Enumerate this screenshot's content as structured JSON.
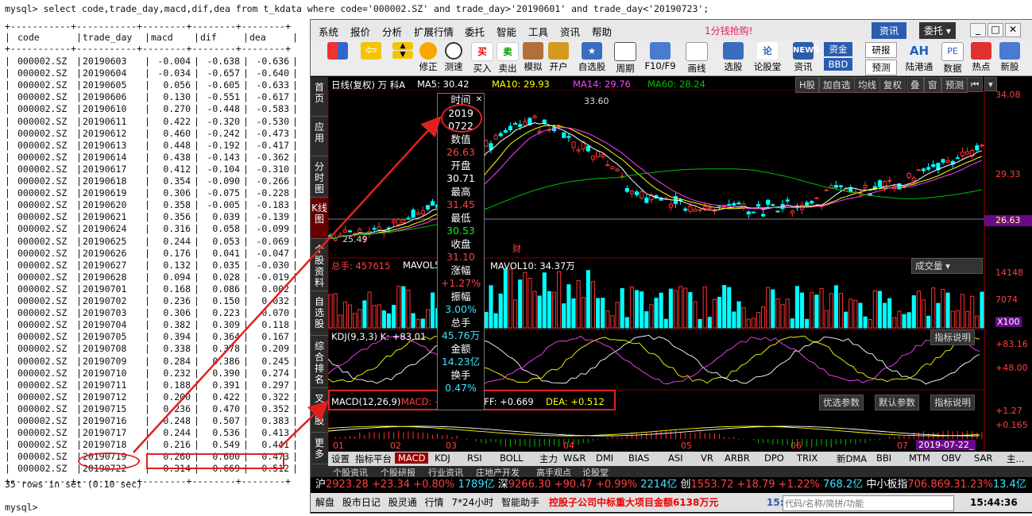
{
  "terminal": {
    "query": "mysql> select code,trade_day,macd,dif,dea from t_kdata where code='000002.SZ' and trade_day>'20190601' and trade_day<'20190723';",
    "headers": [
      "code",
      "trade_day",
      "macd",
      "dif",
      "dea"
    ],
    "rows": [
      [
        "000002.SZ",
        "20190603",
        "-0.004",
        "-0.638",
        "-0.636"
      ],
      [
        "000002.SZ",
        "20190604",
        "-0.034",
        "-0.657",
        "-0.640"
      ],
      [
        "000002.SZ",
        "20190605",
        "0.056",
        "-0.605",
        "-0.633"
      ],
      [
        "000002.SZ",
        "20190606",
        "0.130",
        "-0.551",
        "-0.617"
      ],
      [
        "000002.SZ",
        "20190610",
        "0.270",
        "-0.448",
        "-0.583"
      ],
      [
        "000002.SZ",
        "20190611",
        "0.422",
        "-0.320",
        "-0.530"
      ],
      [
        "000002.SZ",
        "20190612",
        "0.460",
        "-0.242",
        "-0.473"
      ],
      [
        "000002.SZ",
        "20190613",
        "0.448",
        "-0.192",
        "-0.417"
      ],
      [
        "000002.SZ",
        "20190614",
        "0.438",
        "-0.143",
        "-0.362"
      ],
      [
        "000002.SZ",
        "20190617",
        "0.412",
        "-0.104",
        "-0.310"
      ],
      [
        "000002.SZ",
        "20190618",
        "0.354",
        "-0.090",
        "-0.266"
      ],
      [
        "000002.SZ",
        "20190619",
        "0.306",
        "-0.075",
        "-0.228"
      ],
      [
        "000002.SZ",
        "20190620",
        "0.358",
        "-0.005",
        "-0.183"
      ],
      [
        "000002.SZ",
        "20190621",
        "0.356",
        "0.039",
        "-0.139"
      ],
      [
        "000002.SZ",
        "20190624",
        "0.316",
        "0.058",
        "-0.099"
      ],
      [
        "000002.SZ",
        "20190625",
        "0.244",
        "0.053",
        "-0.069"
      ],
      [
        "000002.SZ",
        "20190626",
        "0.176",
        "0.041",
        "-0.047"
      ],
      [
        "000002.SZ",
        "20190627",
        "0.132",
        "0.035",
        "-0.030"
      ],
      [
        "000002.SZ",
        "20190628",
        "0.094",
        "0.028",
        "-0.019"
      ],
      [
        "000002.SZ",
        "20190701",
        "0.168",
        "0.086",
        "0.002"
      ],
      [
        "000002.SZ",
        "20190702",
        "0.236",
        "0.150",
        "0.032"
      ],
      [
        "000002.SZ",
        "20190703",
        "0.306",
        "0.223",
        "0.070"
      ],
      [
        "000002.SZ",
        "20190704",
        "0.382",
        "0.309",
        "0.118"
      ],
      [
        "000002.SZ",
        "20190705",
        "0.394",
        "0.364",
        "0.167"
      ],
      [
        "000002.SZ",
        "20190708",
        "0.338",
        "0.378",
        "0.209"
      ],
      [
        "000002.SZ",
        "20190709",
        "0.284",
        "0.386",
        "0.245"
      ],
      [
        "000002.SZ",
        "20190710",
        "0.232",
        "0.390",
        "0.274"
      ],
      [
        "000002.SZ",
        "20190711",
        "0.188",
        "0.391",
        "0.297"
      ],
      [
        "000002.SZ",
        "20190712",
        "0.200",
        "0.422",
        "0.322"
      ],
      [
        "000002.SZ",
        "20190715",
        "0.236",
        "0.470",
        "0.352"
      ],
      [
        "000002.SZ",
        "20190716",
        "0.248",
        "0.507",
        "0.383"
      ],
      [
        "000002.SZ",
        "20190717",
        "0.244",
        "0.536",
        "0.413"
      ],
      [
        "000002.SZ",
        "20190718",
        "0.216",
        "0.549",
        "0.441"
      ],
      [
        "000002.SZ",
        "20190719",
        "0.260",
        "0.600",
        "0.473"
      ],
      [
        "000002.SZ",
        "20190722",
        "0.314",
        "0.669",
        "0.512"
      ]
    ],
    "summary": "35 rows in set (0.10 sec)",
    "prompt": "mysql>"
  },
  "menubar": {
    "items": [
      "系统",
      "报价",
      "分析",
      "扩展行情",
      "委托",
      "智能",
      "工具",
      "资讯",
      "帮助"
    ],
    "promo": "1分钱抢购!",
    "btn_info": "资讯",
    "btn_trade": "委托"
  },
  "toolbar": {
    "buttons": [
      "修正",
      "测速",
      "买入",
      "卖出",
      "模拟",
      "开户",
      "自选股",
      "周期",
      "F10/F9",
      "画线",
      "选股",
      "论股堂",
      "资讯",
      "资金",
      "研报",
      "陆港通",
      "数据",
      "热点",
      "新股"
    ],
    "news_label": "NEWS",
    "bbd_label": "BBD",
    "yuce_label": "预测",
    "ah_label": "AH",
    "pe_label": "PE"
  },
  "sidetabs": [
    "首页",
    "应用",
    "分时图",
    "K线图",
    "个股资料",
    "自选股",
    "综合排名",
    "叉诊股",
    "更多"
  ],
  "kline": {
    "header_prefix": "日线(复权)  万 科A",
    "ma5": "MA5: 30.42",
    "ma10": "MA10: 29.93",
    "ma14": "MA14: 29.76",
    "ma60": "MA60: 28.24",
    "top_buttons": [
      "H股",
      "加自选",
      "均线",
      "复权",
      "叠",
      "窗",
      "预测"
    ],
    "y_top": "34.08",
    "y_mid": "29.33",
    "y_cur": "26.63",
    "high_label": "33.60",
    "low_label": "25.49",
    "cai_label": "财",
    "colors": {
      "ma5": "#ffffff",
      "ma10": "#ffff00",
      "ma14": "#ff40ff",
      "ma60": "#00c000",
      "up": "#ff3030",
      "down": "#00ffff"
    }
  },
  "volume": {
    "header": "总手: 457615",
    "mavol5": "MAVOL5",
    "mavol10": "MAVOL10: 34.37万",
    "selector": "成交量",
    "y_top": "14148",
    "y_mid": "7074",
    "y_unit": "X100"
  },
  "kdj": {
    "header": "KDJ(9,3,3) K: +83.01",
    "explain": "指标说明",
    "y_top": "+83.16",
    "y_mid": "+48.00"
  },
  "macd": {
    "label": "MACD(12,26,9)",
    "macd_val": "MACD: +0.313",
    "diff_val": "DIFF: +0.669",
    "dea_val": "DEA: +0.512",
    "btn_opt": "优选参数",
    "btn_default": "默认参数",
    "btn_explain": "指标说明",
    "y_top": "+1.27",
    "y_mid": "+0.165"
  },
  "xaxis": {
    "months": [
      "01",
      "02",
      "03",
      "04",
      "05",
      "06",
      "07"
    ],
    "current": "2019-07-22_"
  },
  "tooltip": {
    "title": "时间",
    "year": "2019",
    "date": "0722",
    "value_label": "数值",
    "value": "26.63",
    "open_label": "开盘",
    "open": "30.71",
    "high_label": "最高",
    "high": "31.45",
    "low_label": "最低",
    "low": "30.53",
    "close_label": "收盘",
    "close": "31.10",
    "change_label": "涨幅",
    "change": "+1.27%",
    "amp_label": "振幅",
    "amp": "3.00%",
    "vol_label": "总手",
    "vol": "45.76万",
    "amount_label": "金额",
    "amount": "14.23亿",
    "turnover_label": "换手",
    "turnover": "0.47%"
  },
  "bottomtabs": [
    "设置",
    "指标平台",
    "MACD",
    "KDJ",
    "RSI",
    "BOLL",
    "主力",
    "W&R",
    "DMI",
    "BIAS",
    "ASI",
    "VR",
    "ARBR",
    "DPO",
    "TRIX",
    "新DMA",
    "BBI",
    "MTM",
    "OBV",
    "SAR",
    "主..."
  ],
  "bottom_row2": [
    "个股资讯",
    "个股研报",
    "行业资讯",
    "庄地产开发",
    "高手观点",
    "论股堂"
  ],
  "ticker": {
    "sh_label": "沪",
    "sh": "2923.28",
    "sh_chg": "+23.34",
    "sh_pct": "+0.80%",
    "sh_amt": "1789亿",
    "sz_label": "深",
    "sz": "9266.30",
    "sz_chg": "+90.47",
    "sz_pct": "+0.99%",
    "sz_amt": "2214亿",
    "cy_label": "创",
    "cy": "1553.72",
    "cy_chg": "+18.79",
    "cy_pct": "+1.22%",
    "cy_amt": "768.2亿",
    "zx_label": "中小板指",
    "zx": "706.869.3",
    "zx_pct": "1.23%",
    "zx_tail": "13.4亿"
  },
  "statusbar": {
    "items": [
      "解盘",
      "股市日记",
      "股灵通",
      "行情",
      "7*24小时",
      "智能助手"
    ],
    "news": "控股子公司中标重大项目金额6138万元",
    "code_prefix": "15:",
    "search_placeholder": "代码/名称/简拼/功能",
    "time": "15:44:36"
  }
}
